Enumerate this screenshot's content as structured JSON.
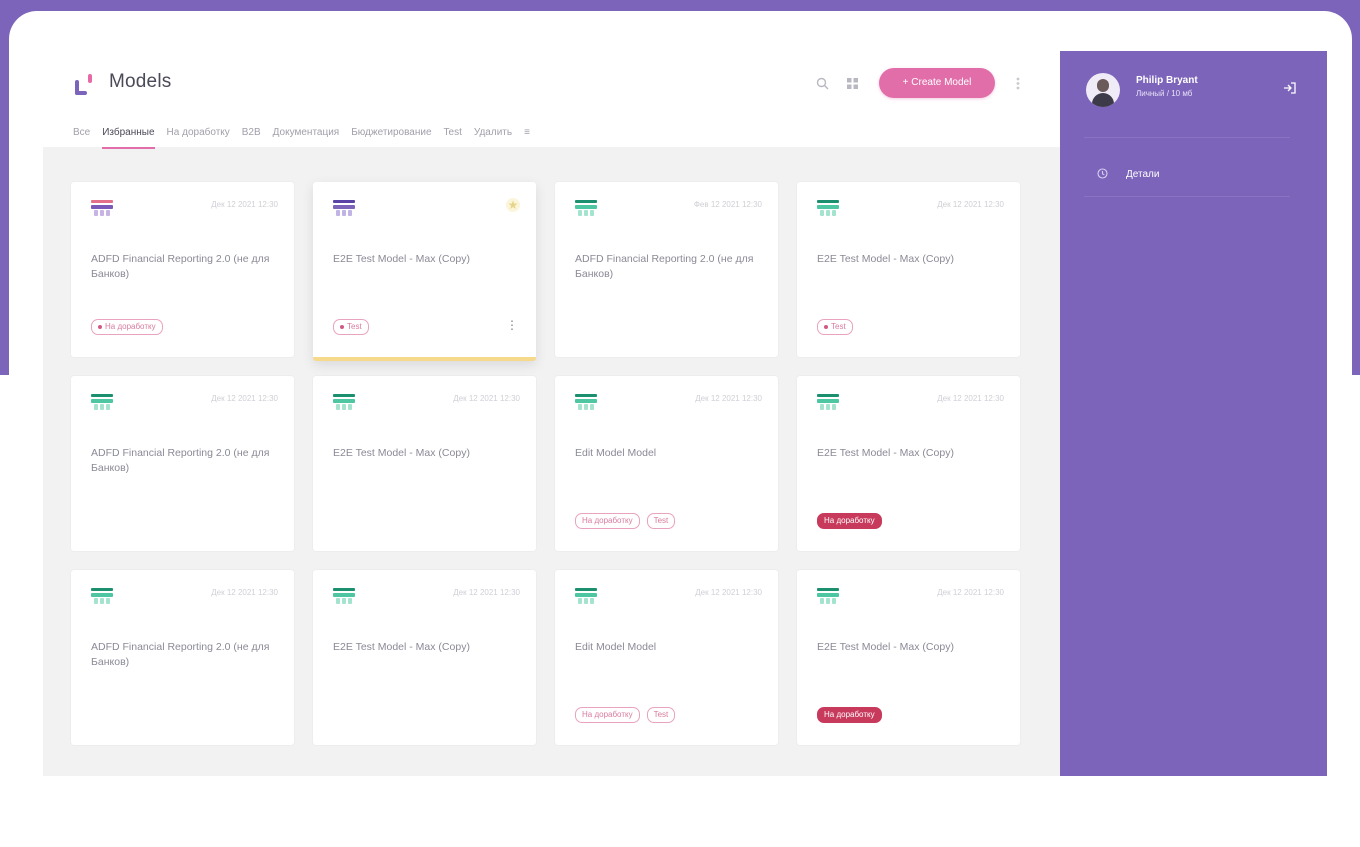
{
  "app": {
    "title": "Models"
  },
  "toolbar": {
    "create_label": "+ Create Model",
    "search_icon": "search-icon",
    "grid_icon": "grid-icon",
    "more_icon": "more-icon"
  },
  "tabs": [
    {
      "label": "Все"
    },
    {
      "label": "Избранные"
    },
    {
      "label": "На доработку"
    },
    {
      "label": "B2B"
    },
    {
      "label": "Документация"
    },
    {
      "label": "Бюджетирование"
    },
    {
      "label": "Test"
    },
    {
      "label": "Удалить"
    }
  ],
  "tabs_more": "≡",
  "cards": [
    {
      "title": "ADFD Financial Reporting 2.0 (не для Банков)",
      "date": "Дек 12 2021 12:30",
      "thumb": "red",
      "star": false,
      "tags": [
        {
          "label": "На доработку",
          "dot": true,
          "solid": false
        }
      ],
      "menu": false,
      "highlight": false
    },
    {
      "title": "E2E Test Model - Max (Copy)",
      "date": "",
      "thumb": "purple",
      "star": true,
      "tags": [
        {
          "label": "Test",
          "dot": true,
          "solid": false
        }
      ],
      "menu": true,
      "highlight": true
    },
    {
      "title": "ADFD Financial Reporting 2.0 (не для Банков)",
      "date": "Фев 12 2021 12:30",
      "thumb": "green",
      "star": false,
      "tags": [],
      "menu": false,
      "highlight": false
    },
    {
      "title": "E2E Test Model - Max (Copy)",
      "date": "Дек 12 2021 12:30",
      "thumb": "green",
      "star": false,
      "tags": [
        {
          "label": "Test",
          "dot": true,
          "solid": false
        }
      ],
      "menu": false,
      "highlight": false
    },
    {
      "title": "ADFD Financial Reporting 2.0 (не для Банков)",
      "date": "Дек 12 2021 12:30",
      "thumb": "green",
      "star": false,
      "tags": [],
      "menu": false,
      "highlight": false
    },
    {
      "title": "E2E Test Model - Max (Copy)",
      "date": "Дек 12 2021 12:30",
      "thumb": "green",
      "star": false,
      "tags": [],
      "menu": false,
      "highlight": false
    },
    {
      "title": "Edit Model Model",
      "date": "Дек 12 2021 12:30",
      "thumb": "green",
      "star": false,
      "tags": [
        {
          "label": "На доработку",
          "dot": false,
          "solid": false
        },
        {
          "label": "Test",
          "dot": false,
          "solid": false
        }
      ],
      "menu": false,
      "highlight": false
    },
    {
      "title": "E2E Test Model - Max (Copy)",
      "date": "Дек 12 2021 12:30",
      "thumb": "green",
      "star": false,
      "tags": [
        {
          "label": "На доработку",
          "dot": false,
          "solid": true
        }
      ],
      "menu": false,
      "highlight": false
    },
    {
      "title": "ADFD Financial Reporting 2.0 (не для Банков)",
      "date": "Дек 12 2021 12:30",
      "thumb": "green",
      "star": false,
      "tags": [],
      "menu": false,
      "highlight": false
    },
    {
      "title": "E2E Test Model - Max (Copy)",
      "date": "Дек 12 2021 12:30",
      "thumb": "green",
      "star": false,
      "tags": [],
      "menu": false,
      "highlight": false
    },
    {
      "title": "Edit Model Model",
      "date": "Дек 12 2021 12:30",
      "thumb": "green",
      "star": false,
      "tags": [
        {
          "label": "На доработку",
          "dot": false,
          "solid": false
        },
        {
          "label": "Test",
          "dot": false,
          "solid": false
        }
      ],
      "menu": false,
      "highlight": false
    },
    {
      "title": "E2E Test Model - Max (Copy)",
      "date": "Дек 12 2021 12:30",
      "thumb": "green",
      "star": false,
      "tags": [
        {
          "label": "На доработку",
          "dot": false,
          "solid": true
        }
      ],
      "menu": false,
      "highlight": false
    }
  ],
  "sidebar": {
    "user_name": "Philip Bryant",
    "user_sub": "Личный / 10 мб",
    "items": [
      {
        "label": "Детали",
        "icon": "clock-icon"
      }
    ]
  },
  "colors": {
    "accent": "#7c64bb",
    "pink": "#e26ea9",
    "tag_solid": "#c83a5c"
  }
}
